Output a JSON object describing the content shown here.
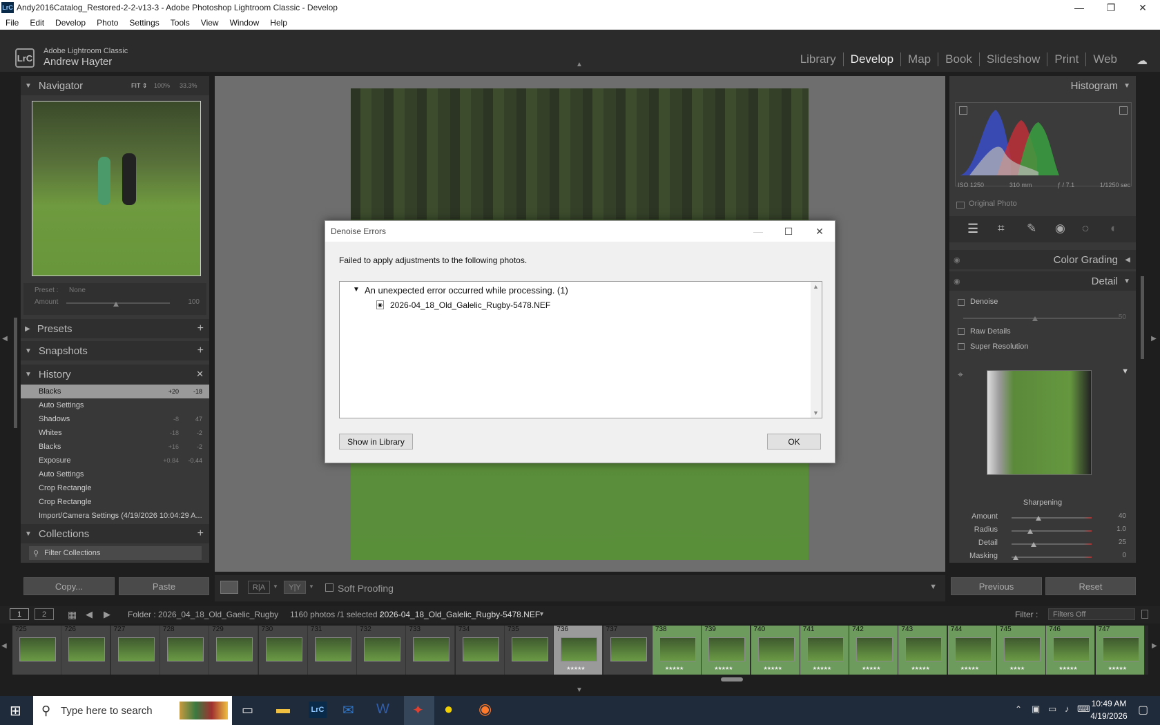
{
  "window": {
    "title": "Andy2016Catalog_Restored-2-2-v13-3 - Adobe Photoshop Lightroom Classic - Develop",
    "app_icon": "LrC"
  },
  "menu": [
    "File",
    "Edit",
    "Develop",
    "Photo",
    "Settings",
    "Tools",
    "View",
    "Window",
    "Help"
  ],
  "brand": {
    "product": "Adobe Lightroom Classic",
    "user": "Andrew Hayter",
    "logo": "LrC"
  },
  "modules": [
    "Library",
    "Develop",
    "Map",
    "Book",
    "Slideshow",
    "Print",
    "Web"
  ],
  "active_module": "Develop",
  "navigator": {
    "title": "Navigator",
    "zoom": [
      "FIT ⇕",
      "100%",
      "33.3%"
    ]
  },
  "preset": {
    "label": "Preset :",
    "value": "None",
    "amount_label": "Amount",
    "amount": "100"
  },
  "panels": {
    "presets": "Presets",
    "snapshots": "Snapshots",
    "history": "History",
    "collections": "Collections",
    "filter_collections": "Filter Collections"
  },
  "history": [
    {
      "name": "Blacks",
      "v1": "+20",
      "v2": "-18",
      "selected": true
    },
    {
      "name": "Auto Settings",
      "v1": "",
      "v2": ""
    },
    {
      "name": "Shadows",
      "v1": "-8",
      "v2": "47"
    },
    {
      "name": "Whites",
      "v1": "-18",
      "v2": "-2"
    },
    {
      "name": "Blacks",
      "v1": "+16",
      "v2": "-2"
    },
    {
      "name": "Exposure",
      "v1": "+0.84",
      "v2": "-0.44"
    },
    {
      "name": "Auto Settings",
      "v1": "",
      "v2": ""
    },
    {
      "name": "Crop Rectangle",
      "v1": "",
      "v2": ""
    },
    {
      "name": "Crop Rectangle",
      "v1": "",
      "v2": ""
    },
    {
      "name": "Import/Camera Settings (4/19/2026 10:04:29 A...",
      "v1": "",
      "v2": ""
    }
  ],
  "left_buttons": {
    "copy": "Copy...",
    "paste": "Paste"
  },
  "toolbar": {
    "soft_proofing": "Soft Proofing",
    "ra": "R|A",
    "yy": "Y|Y"
  },
  "histogram": {
    "title": "Histogram",
    "iso": "ISO 1250",
    "focal": "310 mm",
    "aperture": "ƒ / 7.1",
    "shutter": "1/1250 sec",
    "original_photo": "Original Photo"
  },
  "right_panels": {
    "color_grading": "Color Grading",
    "detail": "Detail"
  },
  "detail": {
    "denoise": "Denoise",
    "denoise_amount": "50",
    "raw_details": "Raw Details",
    "super_resolution": "Super Resolution",
    "sharpening": "Sharpening",
    "rows": [
      {
        "label": "Amount",
        "value": "40",
        "level": 0.34
      },
      {
        "label": "Radius",
        "value": "1.0",
        "level": 0.23
      },
      {
        "label": "Detail",
        "value": "25",
        "level": 0.28
      },
      {
        "label": "Masking",
        "value": "0",
        "level": 0.05
      }
    ]
  },
  "right_buttons": {
    "previous": "Previous",
    "reset": "Reset"
  },
  "filmbar": {
    "view1": "1",
    "view2": "2",
    "folder_label": "Folder : 2026_04_18_Old_Gaelic_Rugby",
    "count": "1160 photos /1 selected /",
    "file": "2026-04_18_Old_Galelic_Rugby-5478.NEF",
    "filter_label": "Filter :",
    "filter_value": "Filters Off"
  },
  "film_thumbs": [
    {
      "n": "725",
      "g": false,
      "s": ""
    },
    {
      "n": "726",
      "g": false,
      "s": ""
    },
    {
      "n": "727",
      "g": false,
      "s": ""
    },
    {
      "n": "728",
      "g": false,
      "s": ""
    },
    {
      "n": "729",
      "g": false,
      "s": ""
    },
    {
      "n": "730",
      "g": false,
      "s": ""
    },
    {
      "n": "731",
      "g": false,
      "s": ""
    },
    {
      "n": "732",
      "g": false,
      "s": ""
    },
    {
      "n": "733",
      "g": false,
      "s": ""
    },
    {
      "n": "734",
      "g": false,
      "s": ""
    },
    {
      "n": "735",
      "g": false,
      "s": ""
    },
    {
      "n": "736",
      "g": false,
      "s": "★★★★★",
      "sel": true
    },
    {
      "n": "737",
      "g": false,
      "s": ""
    },
    {
      "n": "738",
      "g": true,
      "s": "★★★★★"
    },
    {
      "n": "739",
      "g": true,
      "s": "★★★★★"
    },
    {
      "n": "740",
      "g": true,
      "s": "★★★★★"
    },
    {
      "n": "741",
      "g": true,
      "s": "★★★★★"
    },
    {
      "n": "742",
      "g": true,
      "s": "★★★★★"
    },
    {
      "n": "743",
      "g": true,
      "s": "★★★★★"
    },
    {
      "n": "744",
      "g": true,
      "s": "★★★★★"
    },
    {
      "n": "745",
      "g": true,
      "s": "★★★★"
    },
    {
      "n": "746",
      "g": true,
      "s": "★★★★★"
    },
    {
      "n": "747",
      "g": true,
      "s": "★★★★★"
    }
  ],
  "dialog": {
    "title": "Denoise Errors",
    "message": "Failed to apply adjustments to the following photos.",
    "error_group": "An unexpected error occurred while processing. (1)",
    "file": "2026-04_18_Old_Galelic_Rugby-5478.NEF",
    "show_in_library": "Show in Library",
    "ok": "OK"
  },
  "taskbar": {
    "search_placeholder": "Type here to search",
    "time": "10:49 AM",
    "date": "4/19/2026"
  }
}
